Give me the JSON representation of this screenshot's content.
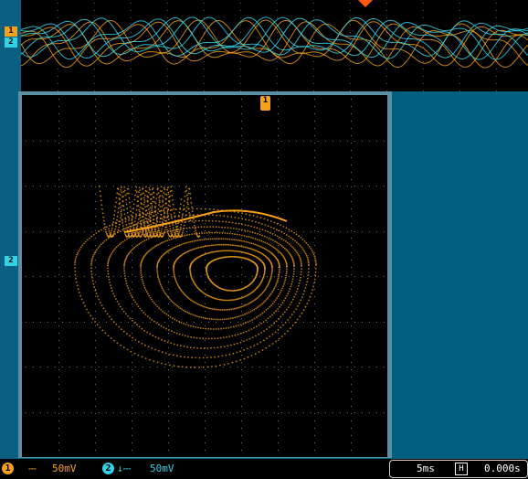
{
  "markers": {
    "ch1": "1",
    "ch2": "2"
  },
  "status": {
    "ch1_badge": "1",
    "ch1_coupling": "⎓",
    "ch1_scale": "50mV",
    "ch2_badge": "2",
    "ch2_coupling": "↓⎓",
    "ch2_scale": "50mV",
    "time_scale": "5ms",
    "h_position_icon": "H",
    "trigger_time": "0.000s"
  },
  "colors": {
    "ch1": "#f7a11a",
    "ch2": "#32d1e6",
    "trigger": "#ff5a14",
    "screen": "#000000",
    "chrome": "#005f80"
  }
}
